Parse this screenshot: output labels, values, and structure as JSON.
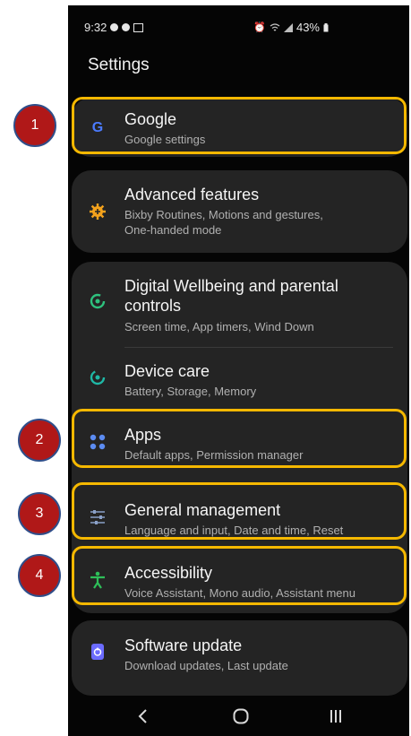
{
  "status_bar": {
    "time": "9:32",
    "battery": "43%"
  },
  "page": {
    "title": "Settings"
  },
  "items": [
    {
      "label": "Google",
      "subtitle": "Google settings",
      "icon": "google-g-icon",
      "color": "#4b7bff"
    },
    {
      "label": "Advanced features",
      "subtitle": "Bixby Routines, Motions and gestures,",
      "subtitle2": "One-handed mode",
      "icon": "gear-plus-icon",
      "color": "#f4a21c"
    },
    {
      "label": "Digital Wellbeing and parental",
      "label2": "controls",
      "subtitle": "Screen time, App timers, Wind Down",
      "icon": "wellbeing-icon",
      "color": "#2ec27e"
    },
    {
      "label": "Device care",
      "subtitle": "Battery, Storage, Memory",
      "icon": "device-care-icon",
      "color": "#1fb8a6"
    },
    {
      "label": "Apps",
      "subtitle": "Default apps, Permission manager",
      "icon": "apps-dots-icon",
      "color": "#5c8cf2"
    },
    {
      "label": "General management",
      "subtitle": "Language and input, Date and time, Reset",
      "icon": "sliders-icon",
      "color": "#8aa0c8"
    },
    {
      "label": "Accessibility",
      "subtitle": "Voice Assistant, Mono audio, Assistant menu",
      "icon": "accessibility-icon",
      "color": "#2ebf59"
    },
    {
      "label": "Software update",
      "subtitle": "Download updates, Last update",
      "icon": "software-update-icon",
      "color": "#6b6bff"
    }
  ],
  "annotations": [
    "1",
    "2",
    "3",
    "4"
  ],
  "highlight_color": "#f5b800",
  "badge_color": "#b01818"
}
